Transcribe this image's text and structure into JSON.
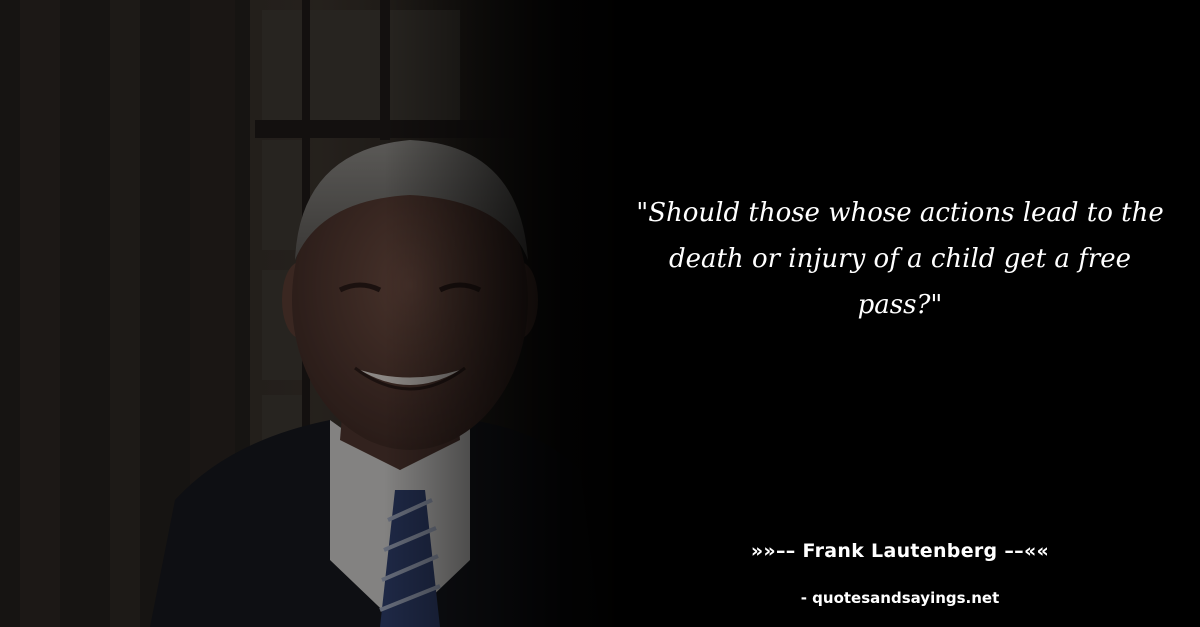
{
  "quote": {
    "text": "\"Should those whose actions lead to the death or injury of a child get a free pass?\""
  },
  "author": {
    "display": "»»–– Frank Lautenberg ––««"
  },
  "source": {
    "text": "- quotesandsayings.net"
  }
}
